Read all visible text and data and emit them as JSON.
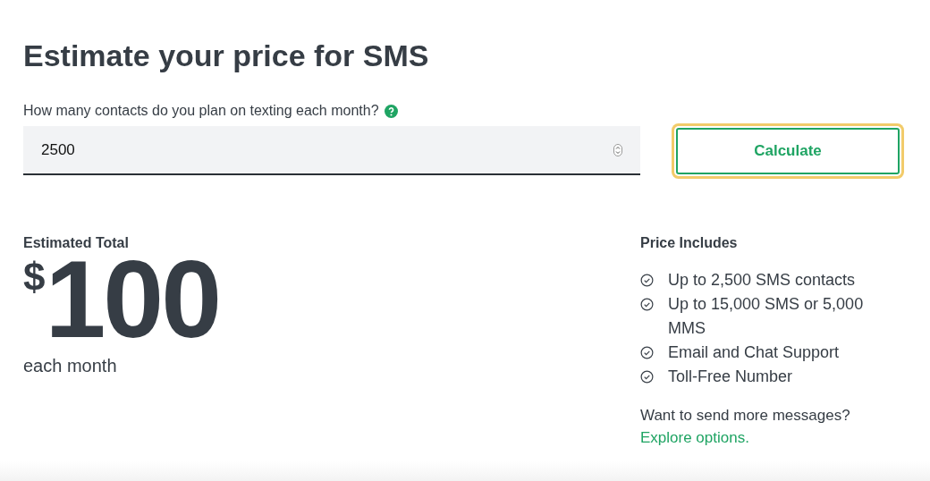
{
  "title": "Estimate your price for SMS",
  "question": {
    "label": "How many contacts do you plan on texting each month?",
    "value": "2500"
  },
  "calculate_button": {
    "label": "Calculate",
    "focused": true
  },
  "estimate": {
    "label": "Estimated Total",
    "currency": "$",
    "amount": "100",
    "period": "each month"
  },
  "includes": {
    "heading": "Price Includes",
    "items": [
      "Up to 2,500 SMS contacts",
      "Up to 15,000 SMS or 5,000 MMS",
      "Email and Chat Support",
      "Toll-Free Number"
    ],
    "more_text": "Want to send more messages?",
    "link": "Explore options."
  }
}
